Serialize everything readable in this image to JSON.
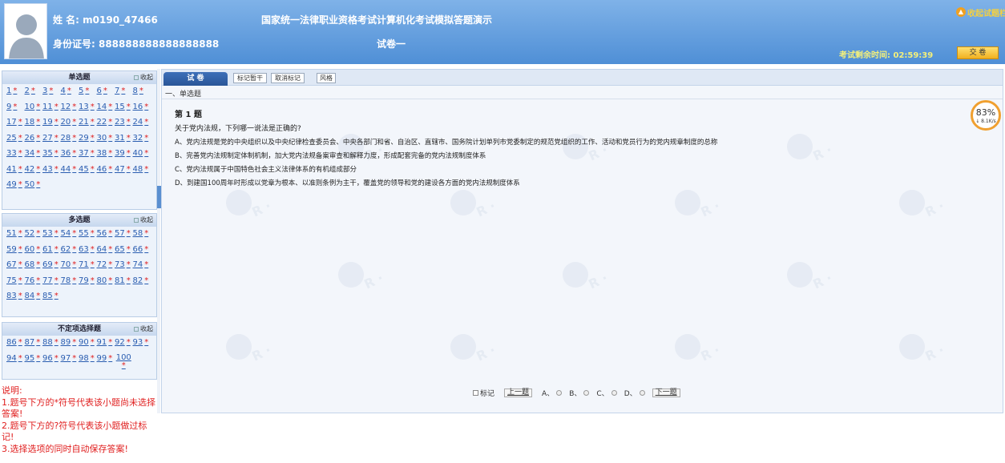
{
  "header": {
    "name_label": "姓 名: m0190_47466",
    "id_label": "身份证号: 888888888888888888",
    "title": "国家统一法律职业资格考试计算机化考试模拟答题演示",
    "paper_name": "试卷一",
    "timer_text": "考试剩余时间: 02:59:39",
    "submit_label": "交 卷",
    "exit_label": "收起试题栏"
  },
  "sidebar": {
    "collapse_label": "收起",
    "single": {
      "title": "单选题",
      "rows": [
        [
          "1",
          "2",
          "3",
          "4",
          "5",
          "6",
          "7",
          "8"
        ],
        [
          "9",
          "10",
          "11",
          "12",
          "13",
          "14",
          "15",
          "16"
        ],
        [
          "17",
          "18",
          "19",
          "20",
          "21",
          "22",
          "23",
          "24"
        ],
        [
          "25",
          "26",
          "27",
          "28",
          "29",
          "30",
          "31",
          "32"
        ],
        [
          "33",
          "34",
          "35",
          "36",
          "37",
          "38",
          "39",
          "40"
        ],
        [
          "41",
          "42",
          "43",
          "44",
          "45",
          "46",
          "47",
          "48"
        ],
        [
          "49",
          "50"
        ]
      ]
    },
    "multi": {
      "title": "多选题",
      "rows": [
        [
          "51",
          "52",
          "53",
          "54",
          "55",
          "56",
          "57",
          "58"
        ],
        [
          "59",
          "60",
          "61",
          "62",
          "63",
          "64",
          "65",
          "66"
        ],
        [
          "67",
          "68",
          "69",
          "70",
          "71",
          "72",
          "73",
          "74"
        ],
        [
          "75",
          "76",
          "77",
          "78",
          "79",
          "80",
          "81",
          "82"
        ],
        [
          "83",
          "84",
          "85"
        ]
      ]
    },
    "indefinite": {
      "title": "不定项选择题",
      "rows": [
        [
          "86",
          "87",
          "88",
          "89",
          "90",
          "91",
          "92",
          "93"
        ],
        [
          "94",
          "95",
          "96",
          "97",
          "98",
          "99",
          "100"
        ]
      ]
    },
    "star": "*",
    "notes": [
      "说明:",
      "1.题号下方的*符号代表该小题尚未选择答案!",
      "2.题号下方的?符号代表该小题做过标记!",
      "3.选择选项的同时自动保存答案!"
    ]
  },
  "main": {
    "tab_label": "试 卷",
    "toolbar": {
      "mark_pending": "标记暂干",
      "unmark": "取消标记",
      "style": "风格"
    },
    "section": "一、单选题",
    "question_number": "第 1 题",
    "stem": "关于党内法规，下列哪一说法是正确的?",
    "options": [
      "A、党内法规是党的中央组织以及中央纪律检查委员会、中央各部门和省、自治区、直辖市、国务院计划单列市党委制定的规范党组织的工作、活动和党员行为的党内规章制度的总称",
      "B、完善党内法规制定体制机制，加大党内法规备案审查和解释力度，形成配套完备的党内法规制度体系",
      "C、党内法规属于中国特色社会主义法律体系的有机组成部分",
      "D、到建国100周年时形成以党章为根本、以准则条例为主干，覆盖党的领导和党的建设各方面的党内法规制度体系"
    ],
    "progress_percent": "83%",
    "progress_speed": "↓ 8.1K/s",
    "bottom": {
      "mark": "标记",
      "prev": "上一题",
      "next": "下一题",
      "choices": [
        "A、",
        "B、",
        "C、",
        "D、"
      ]
    }
  }
}
